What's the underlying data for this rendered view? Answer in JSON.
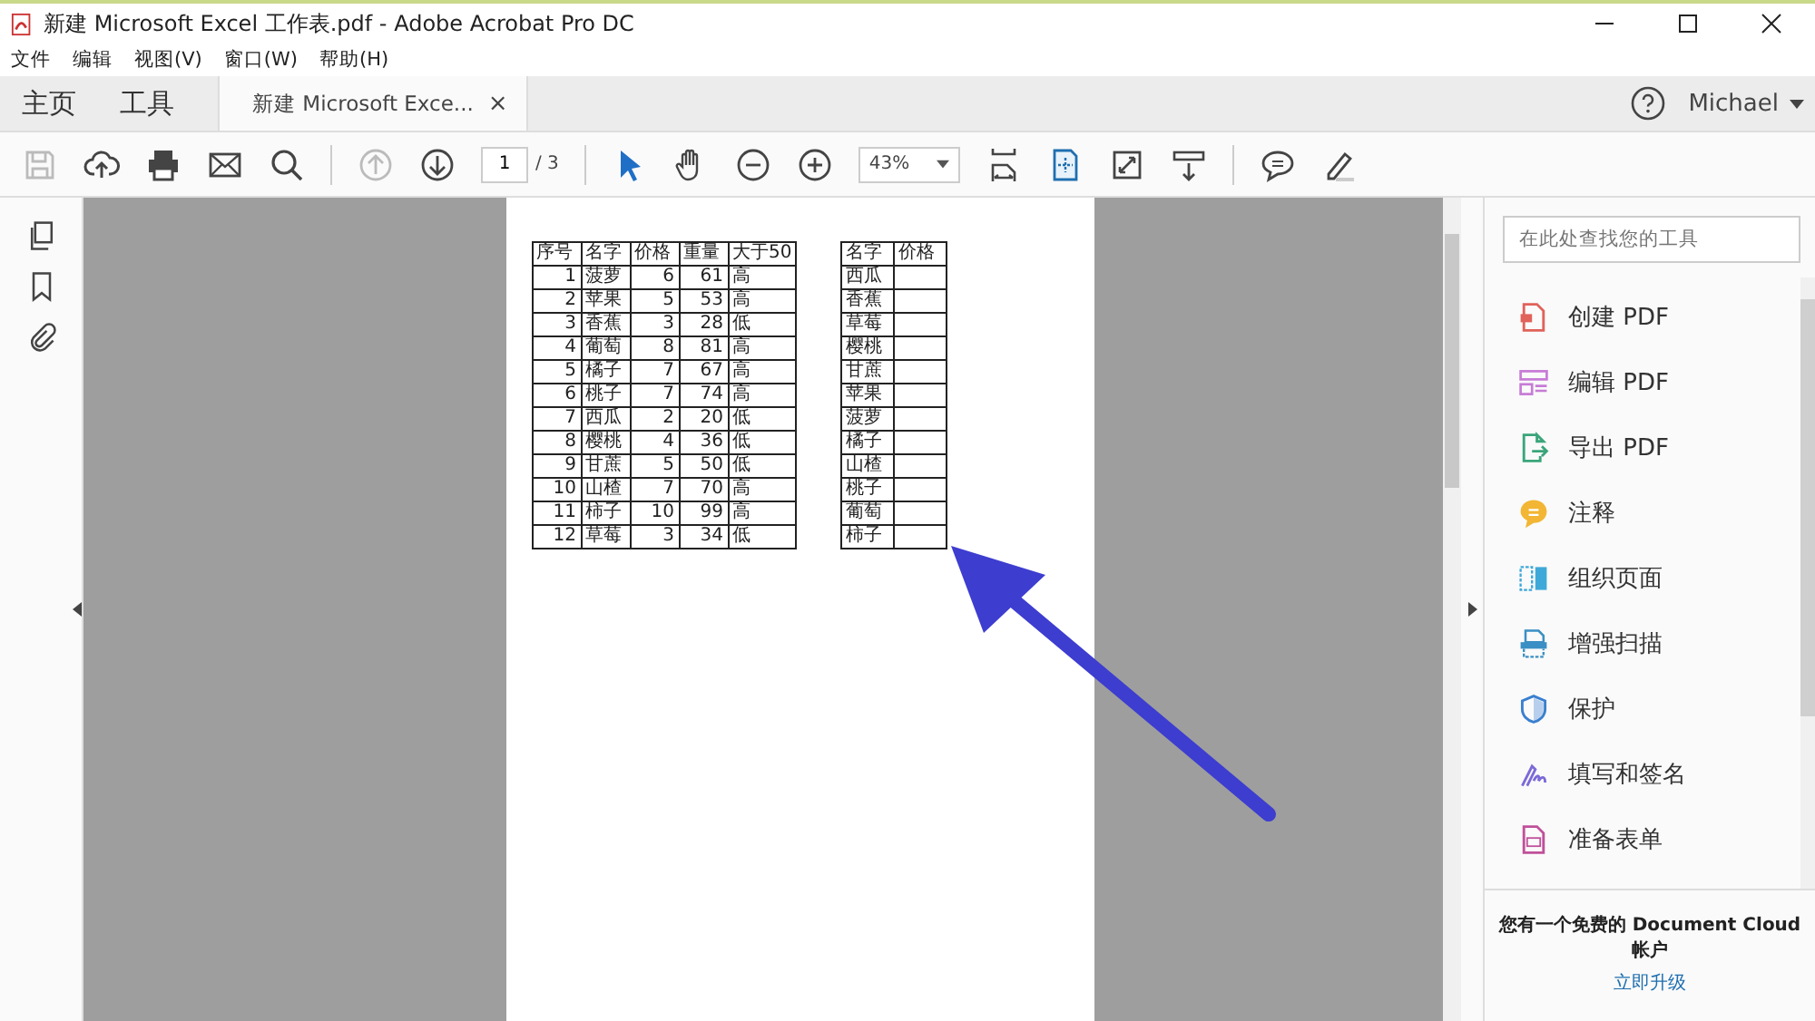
{
  "window": {
    "title": "新建 Microsoft Excel 工作表.pdf - Adobe Acrobat Pro DC"
  },
  "menu": [
    "文件",
    "编辑",
    "视图(V)",
    "窗口(W)",
    "帮助(H)"
  ],
  "nav_tabs": [
    {
      "label": "主页",
      "selected": false
    },
    {
      "label": "工具",
      "selected": false
    }
  ],
  "doc_tabs": [
    {
      "label": "新建 Microsoft Exce...",
      "selected": true,
      "close": "×"
    }
  ],
  "user": {
    "name": "Michael"
  },
  "toolbar": {
    "page": "1",
    "page_total": "/ 3",
    "zoom": "43%"
  },
  "table_1": {
    "columns": [
      "序号",
      "名字",
      "价格",
      "重量",
      "大于50"
    ],
    "rows": [
      [
        "1",
        "菠萝",
        "6",
        "61",
        "高"
      ],
      [
        "2",
        "苹果",
        "5",
        "53",
        "高"
      ],
      [
        "3",
        "香蕉",
        "3",
        "28",
        "低"
      ],
      [
        "4",
        "葡萄",
        "8",
        "81",
        "高"
      ],
      [
        "5",
        "橘子",
        "7",
        "67",
        "高"
      ],
      [
        "6",
        "桃子",
        "7",
        "74",
        "高"
      ],
      [
        "7",
        "西瓜",
        "2",
        "20",
        "低"
      ],
      [
        "8",
        "樱桃",
        "4",
        "36",
        "低"
      ],
      [
        "9",
        "甘蔗",
        "5",
        "50",
        "低"
      ],
      [
        "10",
        "山楂",
        "7",
        "70",
        "高"
      ],
      [
        "11",
        "柿子",
        "10",
        "99",
        "高"
      ],
      [
        "12",
        "草莓",
        "3",
        "34",
        "低"
      ]
    ]
  },
  "table_2": {
    "columns": [
      "名字",
      "价格"
    ],
    "rows": [
      [
        "西瓜"
      ],
      [
        "香蕉"
      ],
      [
        "草莓"
      ],
      [
        "樱桃"
      ],
      [
        "甘蔗"
      ],
      [
        "苹果"
      ],
      [
        "菠萝"
      ],
      [
        "橘子"
      ],
      [
        "山楂"
      ],
      [
        "桃子"
      ],
      [
        "葡萄"
      ],
      [
        "柿子"
      ]
    ]
  },
  "tools_panel": {
    "search": {
      "placeholder": "在此处查找您的工具"
    },
    "items": [
      {
        "label": "创建 PDF",
        "kind": "create",
        "color": "#e0625a"
      },
      {
        "label": "编辑 PDF",
        "kind": "edit",
        "color": "#c77bd6"
      },
      {
        "label": "导出 PDF",
        "kind": "export",
        "color": "#3aa57a"
      },
      {
        "label": "注释",
        "kind": "comment",
        "color": "#f2b634"
      },
      {
        "label": "组织页面",
        "kind": "organize",
        "color": "#3ea8d8"
      },
      {
        "label": "增强扫描",
        "kind": "scan",
        "color": "#3a8fc4"
      },
      {
        "label": "保护",
        "kind": "protect",
        "color": "#3a7fd0"
      },
      {
        "label": "填写和签名",
        "kind": "sign",
        "color": "#7b6ad8"
      },
      {
        "label": "准备表单",
        "kind": "form",
        "color": "#c0509a"
      }
    ],
    "footer": {
      "text": "您有一个免费的 Document Cloud 帐户",
      "link": "立即升级"
    }
  }
}
